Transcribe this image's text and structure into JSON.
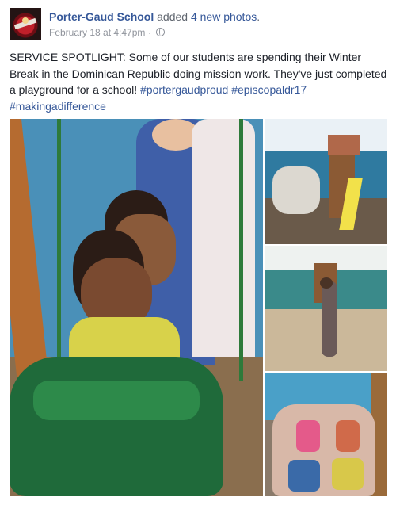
{
  "post": {
    "page_name": "Porter-Gaud School",
    "action_text": " added ",
    "photos_link": "4 new photos",
    "action_end": ".",
    "timestamp": "February 18 at 4:47pm",
    "separator": " · ",
    "privacy_icon": "globe-icon",
    "body_text": "SERVICE SPOTLIGHT: Some of our students are spending their Winter Break in the Dominican Republic doing mission work. They've just completed a playground for a school! ",
    "hashtags": [
      "#portergaudproud",
      "#episcopaldr17",
      "#makingadifference"
    ]
  },
  "photos": [
    {
      "id": "main",
      "alt": "Girls on playground swing"
    },
    {
      "id": "r1",
      "alt": "Students near wooden playset with yellow slide"
    },
    {
      "id": "r2",
      "alt": "Person in yard with playset and swings"
    },
    {
      "id": "r3",
      "alt": "Group photo of students and children"
    }
  ],
  "colors": {
    "link": "#365899",
    "meta": "#90949c",
    "text": "#1d2129"
  }
}
